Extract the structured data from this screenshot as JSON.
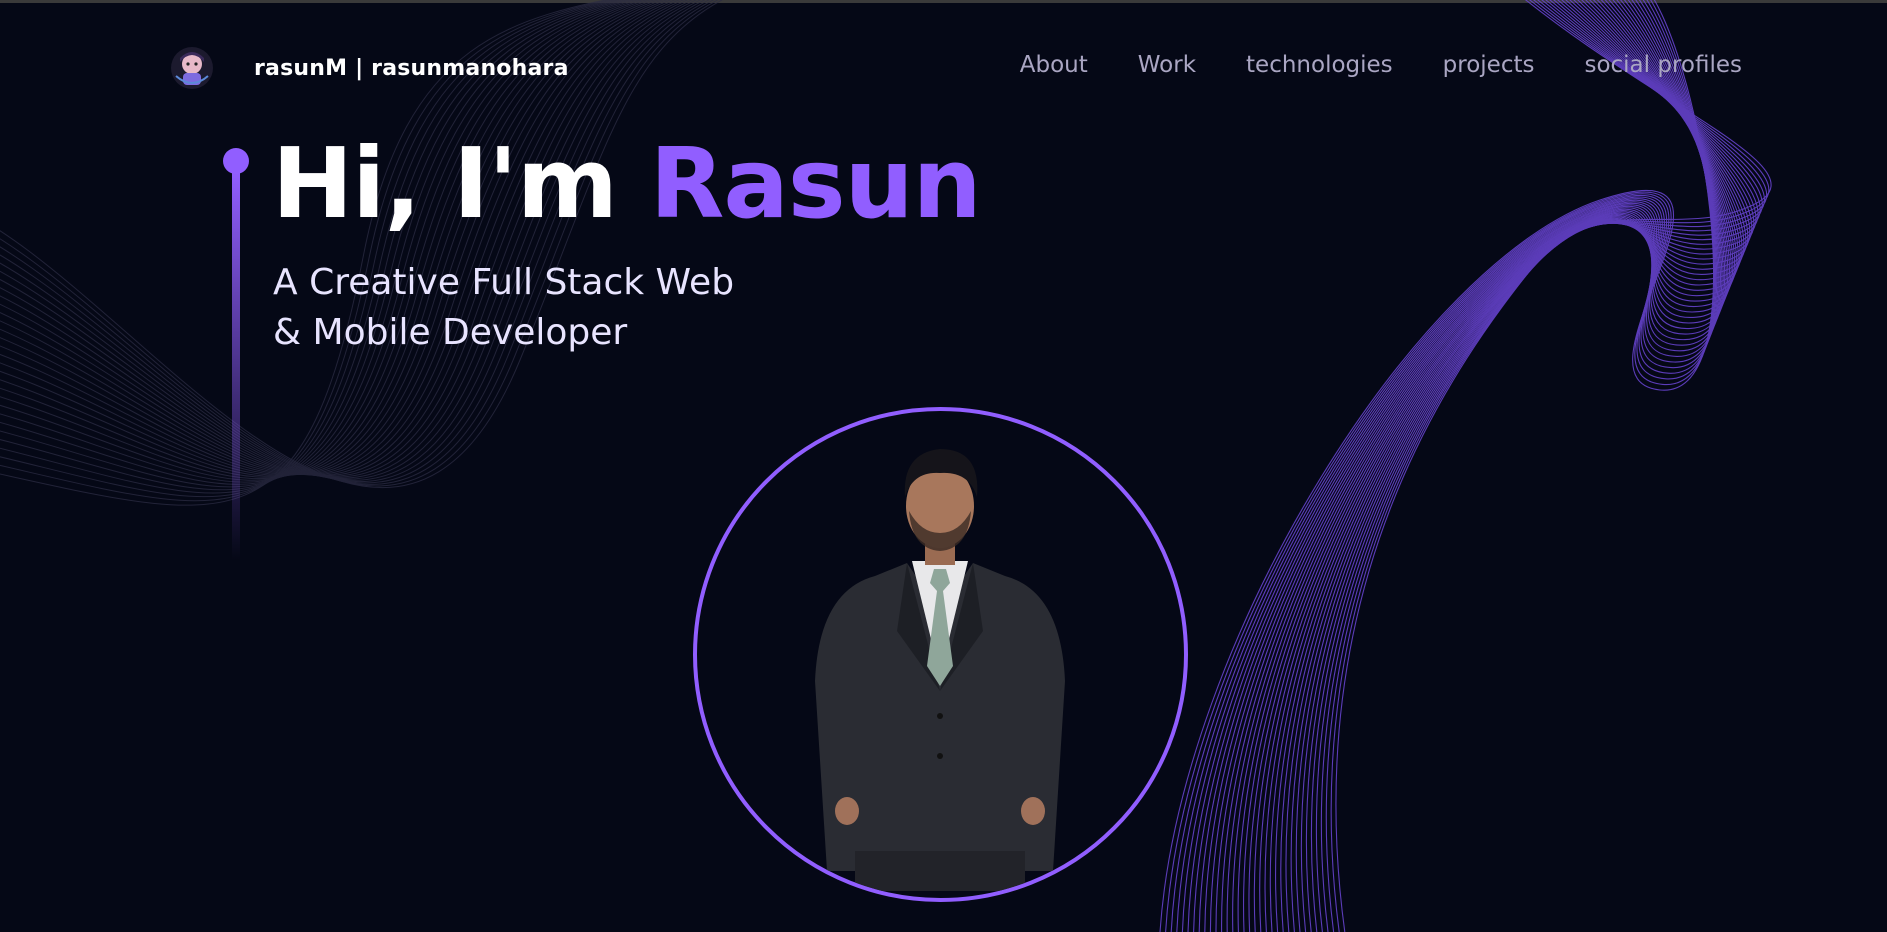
{
  "header": {
    "logo_icon": "avatar-logo-icon",
    "brand_name": "rasunM  | rasunmanohara",
    "nav": [
      {
        "label": "About"
      },
      {
        "label": "Work"
      },
      {
        "label": "technologies"
      },
      {
        "label": "projects"
      },
      {
        "label": "social profiles"
      }
    ]
  },
  "hero": {
    "greeting": "Hi, I'm ",
    "name": "Rasun",
    "tagline_line1": "A Creative Full Stack Web",
    "tagline_line2": "& Mobile Developer",
    "portrait_icon": "developer-portrait-photo"
  },
  "colors": {
    "background": "#050816",
    "accent": "#915eff",
    "nav_text": "#aaa6c3",
    "tagline_text": "#e8e4ff"
  }
}
